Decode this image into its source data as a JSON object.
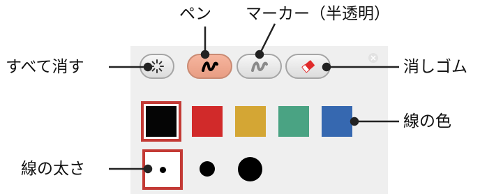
{
  "toolbar": {
    "tools": [
      {
        "id": "clear",
        "icon": "sparkle-clear-icon"
      },
      {
        "id": "pen",
        "icon": "pen-squiggle-icon",
        "selected": true
      },
      {
        "id": "marker",
        "icon": "marker-squiggle-icon"
      },
      {
        "id": "eraser",
        "icon": "eraser-icon"
      }
    ],
    "close_symbol": "×"
  },
  "colors": {
    "selected": "#050505",
    "options": [
      "#050505",
      "#d12a2a",
      "#d4a634",
      "#4aa383",
      "#3668b0"
    ],
    "selection_border": "#c33a35"
  },
  "sizes": {
    "options": [
      "small",
      "medium",
      "large"
    ],
    "selected": "small"
  },
  "callouts": {
    "clear_all": "すべて消す",
    "pen": "ペン",
    "marker": "マーカー（半透明）",
    "eraser": "消しゴム",
    "line_color": "線の色",
    "line_width": "線の太さ"
  }
}
